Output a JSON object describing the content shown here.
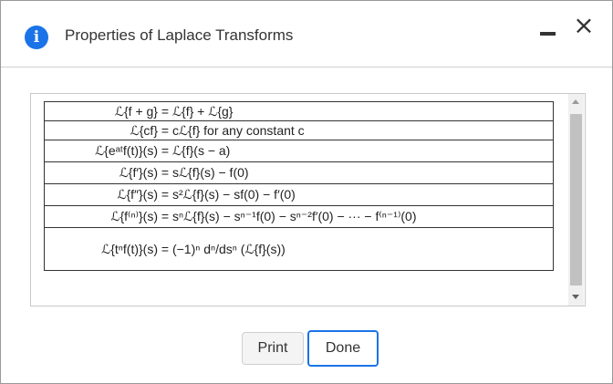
{
  "window": {
    "title": "Properties of Laplace Transforms",
    "icon": "info-icon",
    "minimize_icon": "minimize-icon",
    "close_icon": "close-icon"
  },
  "table": {
    "rows": [
      {
        "lhs": "ℒ{f + g}",
        "rhs": "= ℒ{f} + ℒ{g}"
      },
      {
        "lhs": "ℒ{cf}",
        "rhs": "= cℒ{f} for any constant c"
      },
      {
        "lhs": "ℒ{eᵃᵗf(t)}(s)",
        "rhs": "= ℒ{f}(s − a)"
      },
      {
        "lhs": "ℒ{f′}(s)",
        "rhs": "= sℒ{f}(s) − f(0)"
      },
      {
        "lhs": "ℒ{f″}(s)",
        "rhs": "= s²ℒ{f}(s) − sf(0) − f′(0)"
      },
      {
        "lhs": "ℒ{f⁽ⁿ⁾}(s)",
        "rhs": "= sⁿℒ{f}(s) − sⁿ⁻¹f(0) − sⁿ⁻²f′(0) − ··· − f⁽ⁿ⁻¹⁾(0)"
      },
      {
        "lhs": "ℒ{tⁿf(t)}(s)",
        "rhs": "= (−1)ⁿ dⁿ/dsⁿ (ℒ{f}(s))"
      }
    ]
  },
  "buttons": {
    "print": "Print",
    "done": "Done"
  },
  "colors": {
    "accent": "#1a73e8"
  }
}
